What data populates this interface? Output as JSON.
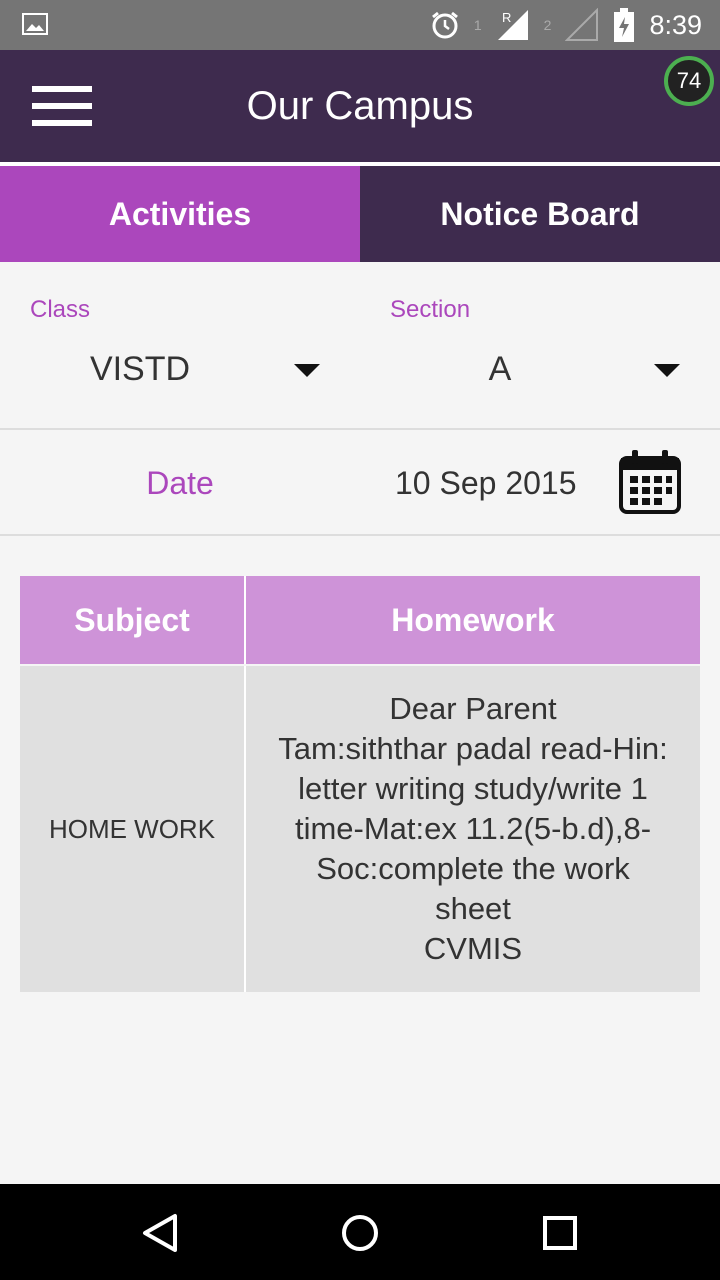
{
  "status_bar": {
    "time": "8:39",
    "sim2_label": "2",
    "sim1_label": "1"
  },
  "app_bar": {
    "title": "Our Campus",
    "badge": "74",
    "badge_color": "#4caf50"
  },
  "tabs": [
    {
      "label": "Activities",
      "active": true
    },
    {
      "label": "Notice Board",
      "active": false
    }
  ],
  "filters": {
    "class": {
      "label": "Class",
      "value": "VISTD"
    },
    "section": {
      "label": "Section",
      "value": "A"
    }
  },
  "date": {
    "label": "Date",
    "value": "10 Sep 2015"
  },
  "table": {
    "headers": [
      "Subject",
      "Homework"
    ],
    "rows": [
      {
        "subject": "HOME WORK",
        "homework_lines": [
          "Dear Parent",
          "Tam:siththar padal read-Hin:",
          "letter writing study/write 1",
          "time-Mat:ex 11.2(5-b.d),8-",
          "Soc:complete the work",
          "sheet",
          "CVMIS"
        ]
      }
    ]
  },
  "colors": {
    "primary_dark": "#3e2b4e",
    "accent": "#ab47bc",
    "table_header": "#ce93d8",
    "table_cell": "#e0e0e0"
  },
  "icons": {
    "status_left": "image-notification-icon",
    "alarm": "alarm-icon",
    "signal": "signal-icon",
    "battery": "battery-charging-icon",
    "menu": "menu-icon",
    "calendar": "calendar-icon",
    "back": "back-icon",
    "home": "home-icon",
    "recents": "recents-icon"
  }
}
